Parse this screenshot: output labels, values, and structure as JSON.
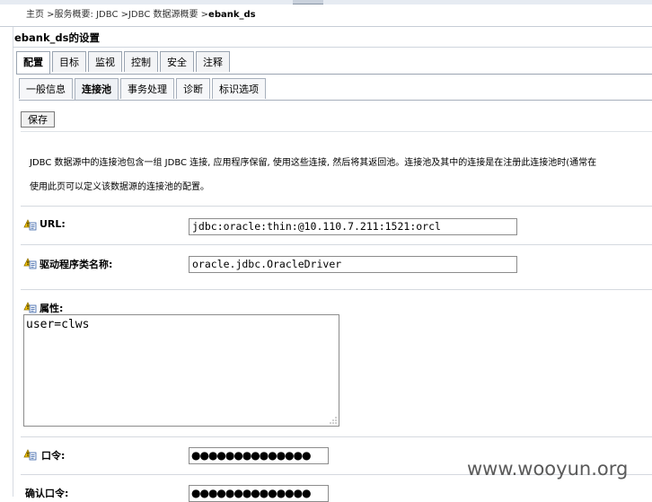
{
  "breadcrumb": {
    "prefix": "主页 >服务概要: JDBC >JDBC 数据源概要 >",
    "current": "ebank_ds"
  },
  "page_title": "ebank_ds的设置",
  "tabs_primary": [
    {
      "label": "配置",
      "active": true
    },
    {
      "label": "目标",
      "active": false
    },
    {
      "label": "监视",
      "active": false
    },
    {
      "label": "控制",
      "active": false
    },
    {
      "label": "安全",
      "active": false
    },
    {
      "label": "注释",
      "active": false
    }
  ],
  "tabs_secondary": [
    {
      "label": "一般信息",
      "active": false
    },
    {
      "label": "连接池",
      "active": true
    },
    {
      "label": "事务处理",
      "active": false
    },
    {
      "label": "诊断",
      "active": false
    },
    {
      "label": "标识选项",
      "active": false
    }
  ],
  "save_label": "保存",
  "description": {
    "line1": "JDBC 数据源中的连接池包含一组 JDBC 连接, 应用程序保留, 使用这些连接, 然后将其返回池。连接池及其中的连接是在注册此连接池时(通常在",
    "line2": "使用此页可以定义该数据源的连接池的配置。"
  },
  "fields": {
    "url": {
      "label": "URL:",
      "value": "jdbc:oracle:thin:@10.110.7.211:1521:orcl"
    },
    "driver": {
      "label": "驱动程序类名称:",
      "value": "oracle.jdbc.OracleDriver"
    },
    "properties": {
      "label": "属性:",
      "value": "user=clws"
    },
    "password": {
      "label": "口令:",
      "masked": "●●●●●●●●●●●●●●"
    },
    "confirm_password": {
      "label": "确认口令:",
      "masked": "●●●●●●●●●●●●●●"
    }
  },
  "watermark": "www.wooyun.org"
}
